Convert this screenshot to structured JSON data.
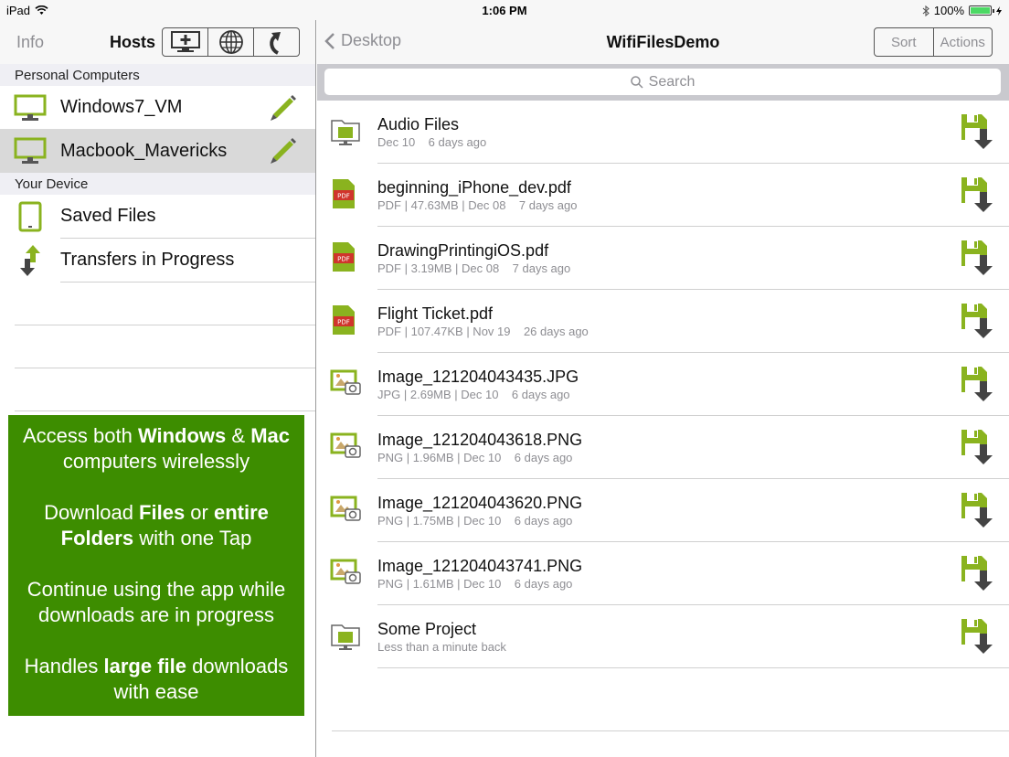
{
  "status_bar": {
    "device": "iPad",
    "time": "1:06 PM",
    "battery": "100%"
  },
  "left_nav": {
    "info_label": "Info",
    "title": "Hosts"
  },
  "sections": {
    "personal_computers": "Personal Computers",
    "your_device": "Your Device"
  },
  "hosts": [
    {
      "label": "Windows7_VM"
    },
    {
      "label": "Macbook_Mavericks"
    }
  ],
  "device_items": [
    {
      "label": "Saved Files"
    },
    {
      "label": "Transfers in Progress"
    }
  ],
  "promo": {
    "p1": {
      "a": "Access both ",
      "b": "Windows",
      "c": " & ",
      "d": "Mac",
      "e": " computers wirelessly"
    },
    "p2": {
      "a": "Download ",
      "b": "Files",
      "c": " or ",
      "d": "entire Folders",
      "e": " with one Tap"
    },
    "p3": "Continue using the app while downloads are in progress",
    "p4": {
      "a": "Handles ",
      "b": "large file",
      "c": " downloads with ease"
    }
  },
  "right_nav": {
    "back_label": "Desktop",
    "title": "WifiFilesDemo",
    "sort_label": "Sort",
    "actions_label": "Actions"
  },
  "search": {
    "placeholder": "Search"
  },
  "files": [
    {
      "name": "Audio Files",
      "meta": "Dec 10    6 days ago",
      "kind": "folder"
    },
    {
      "name": "beginning_iPhone_dev.pdf",
      "meta": "PDF | 47.63MB | Dec 08    7 days ago",
      "kind": "pdf"
    },
    {
      "name": "DrawingPrintingiOS.pdf",
      "meta": "PDF | 3.19MB | Dec 08    7 days ago",
      "kind": "pdf"
    },
    {
      "name": "Flight Ticket.pdf",
      "meta": "PDF | 107.47KB | Nov 19    26 days ago",
      "kind": "pdf"
    },
    {
      "name": "Image_121204043435.JPG",
      "meta": "JPG | 2.69MB | Dec 10    6 days ago",
      "kind": "image"
    },
    {
      "name": "Image_121204043618.PNG",
      "meta": "PNG | 1.96MB | Dec 10    6 days ago",
      "kind": "image"
    },
    {
      "name": "Image_121204043620.PNG",
      "meta": "PNG | 1.75MB | Dec 10    6 days ago",
      "kind": "image"
    },
    {
      "name": "Image_121204043741.PNG",
      "meta": "PNG | 1.61MB | Dec 10    6 days ago",
      "kind": "image"
    },
    {
      "name": "Some Project",
      "meta": "Less than a minute back",
      "kind": "folder"
    }
  ],
  "colors": {
    "accent_green": "#8ab31f",
    "promo_green": "#3d8d00",
    "pdf_red": "#d0342c"
  }
}
